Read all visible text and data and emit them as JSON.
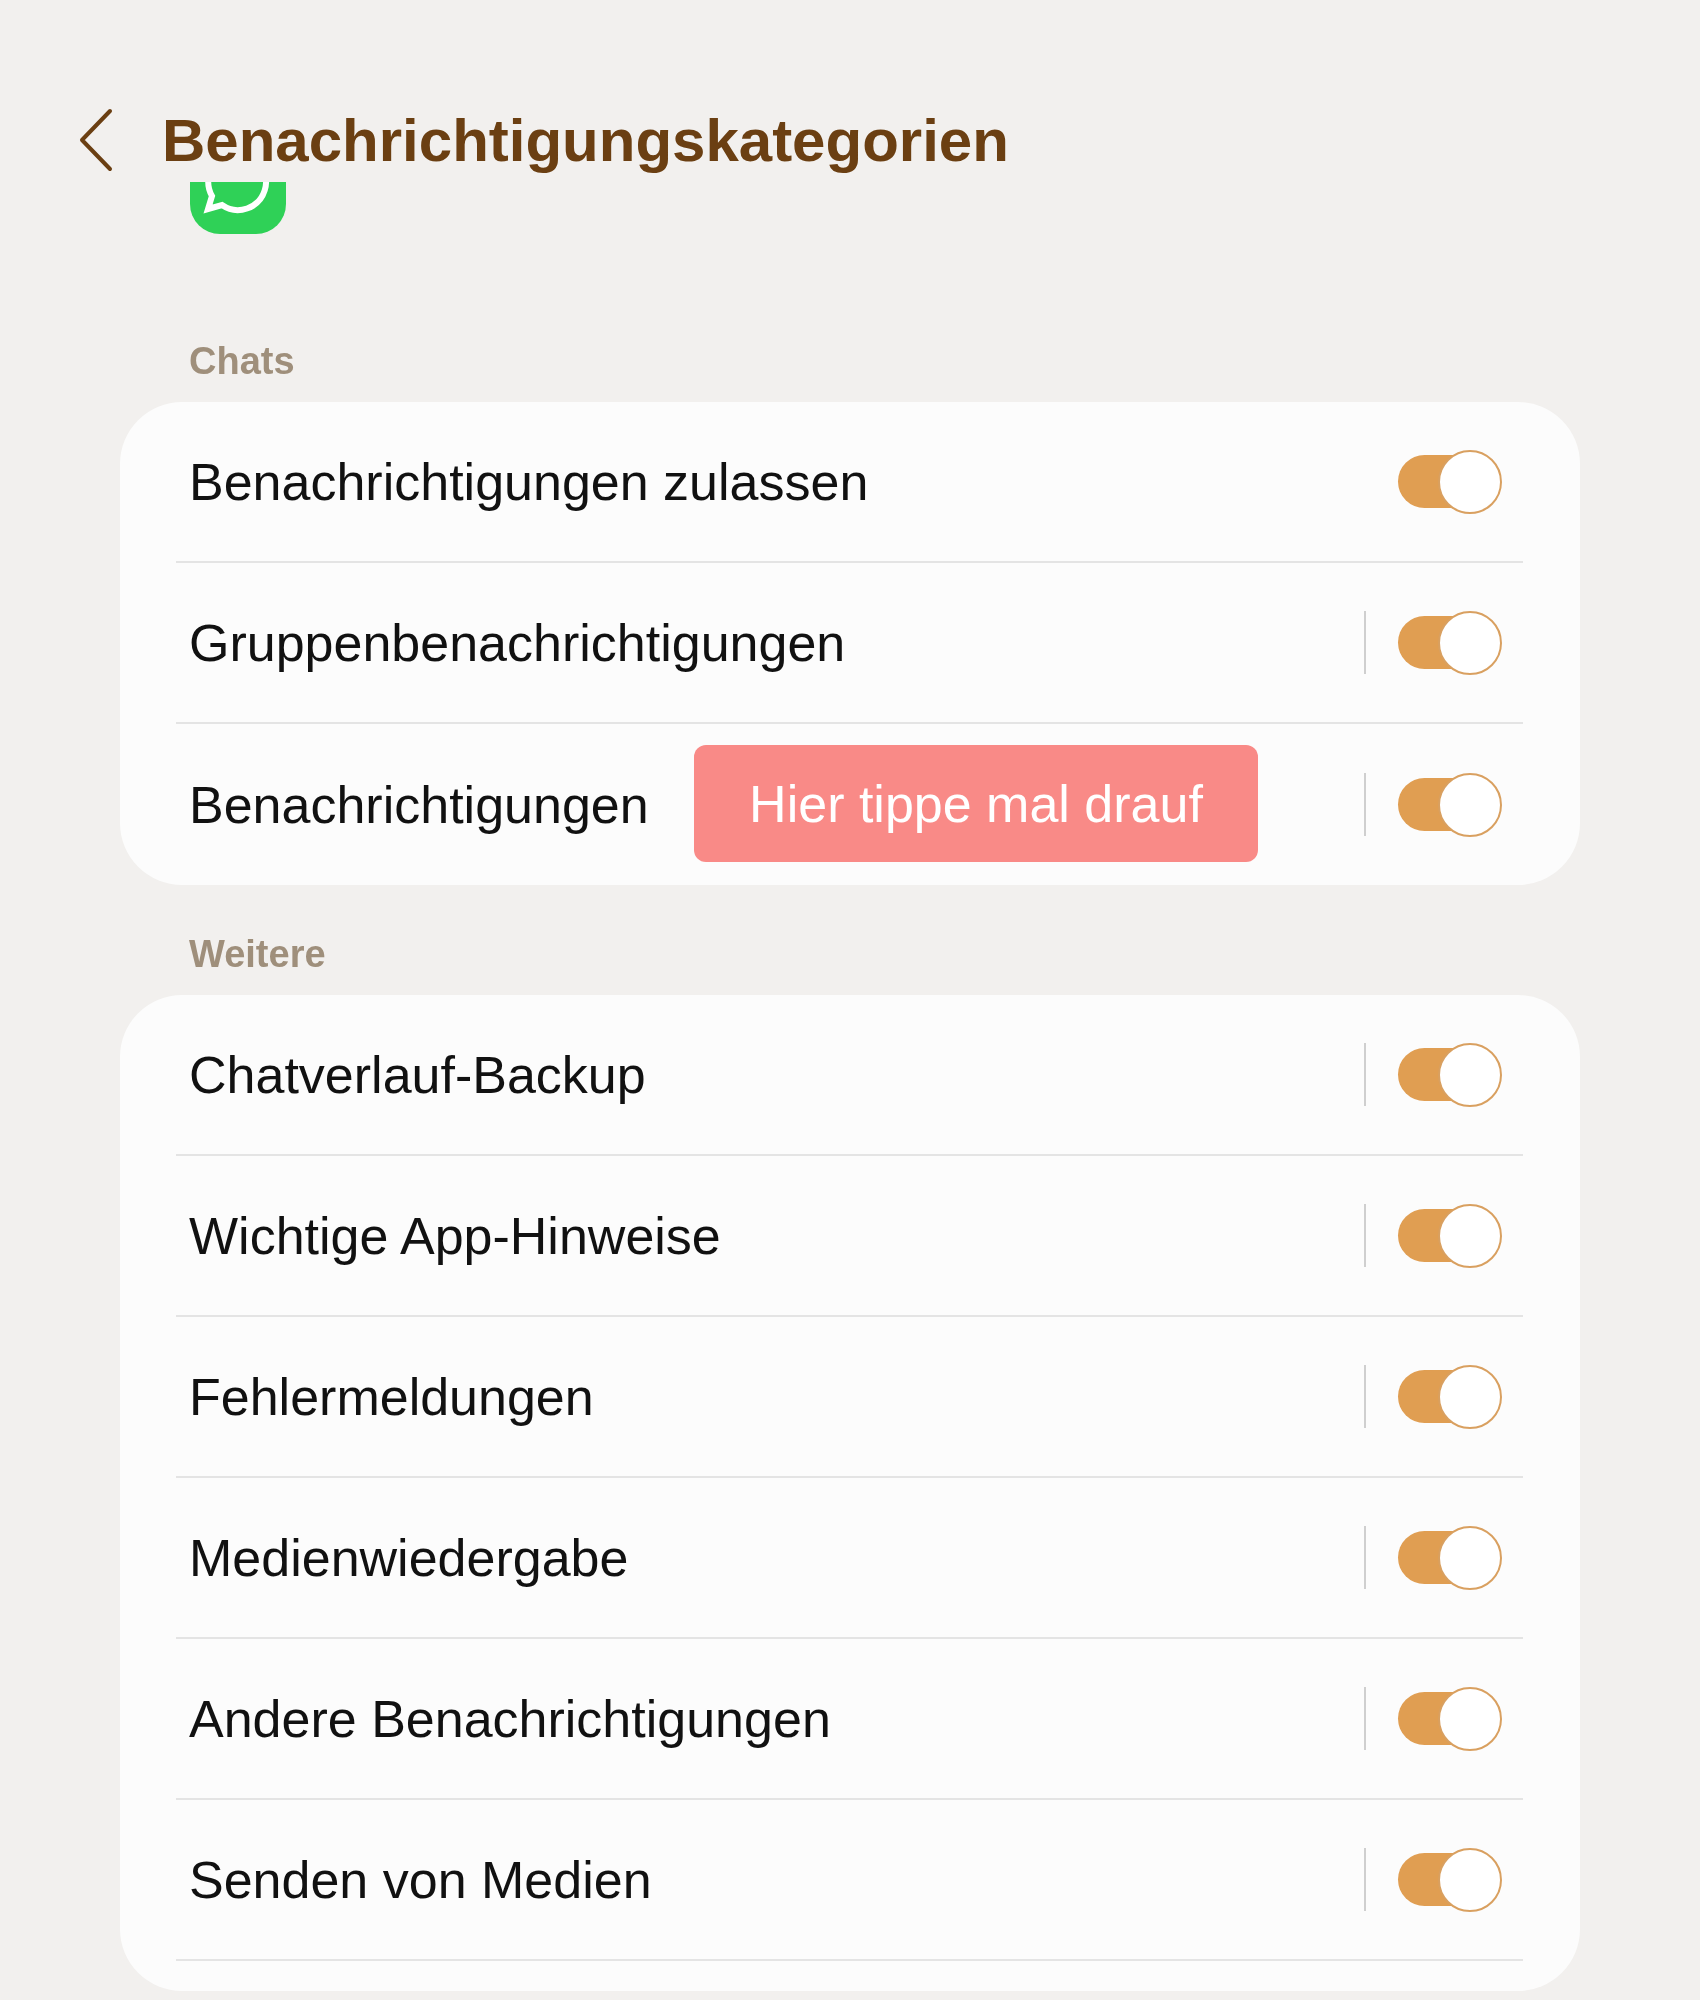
{
  "header": {
    "title": "Benachrichtigungskategorien"
  },
  "sections": [
    {
      "title": "Chats",
      "items": [
        {
          "label": "Benachrichtigungen zulassen",
          "on": true,
          "split": false
        },
        {
          "label": "Gruppenbenachrichtigungen",
          "on": true,
          "split": true
        },
        {
          "label": "Benachrichtigungen",
          "on": true,
          "split": true,
          "callout": "Hier tippe mal drauf"
        }
      ]
    },
    {
      "title": "Weitere",
      "items": [
        {
          "label": "Chatverlauf-Backup",
          "on": true,
          "split": true
        },
        {
          "label": "Wichtige App-Hinweise",
          "on": true,
          "split": true
        },
        {
          "label": "Fehlermeldungen",
          "on": true,
          "split": true
        },
        {
          "label": "Medienwiedergabe",
          "on": true,
          "split": true
        },
        {
          "label": "Andere Benachrichtigungen",
          "on": true,
          "split": true
        },
        {
          "label": "Senden von Medien",
          "on": true,
          "split": true
        }
      ]
    }
  ]
}
